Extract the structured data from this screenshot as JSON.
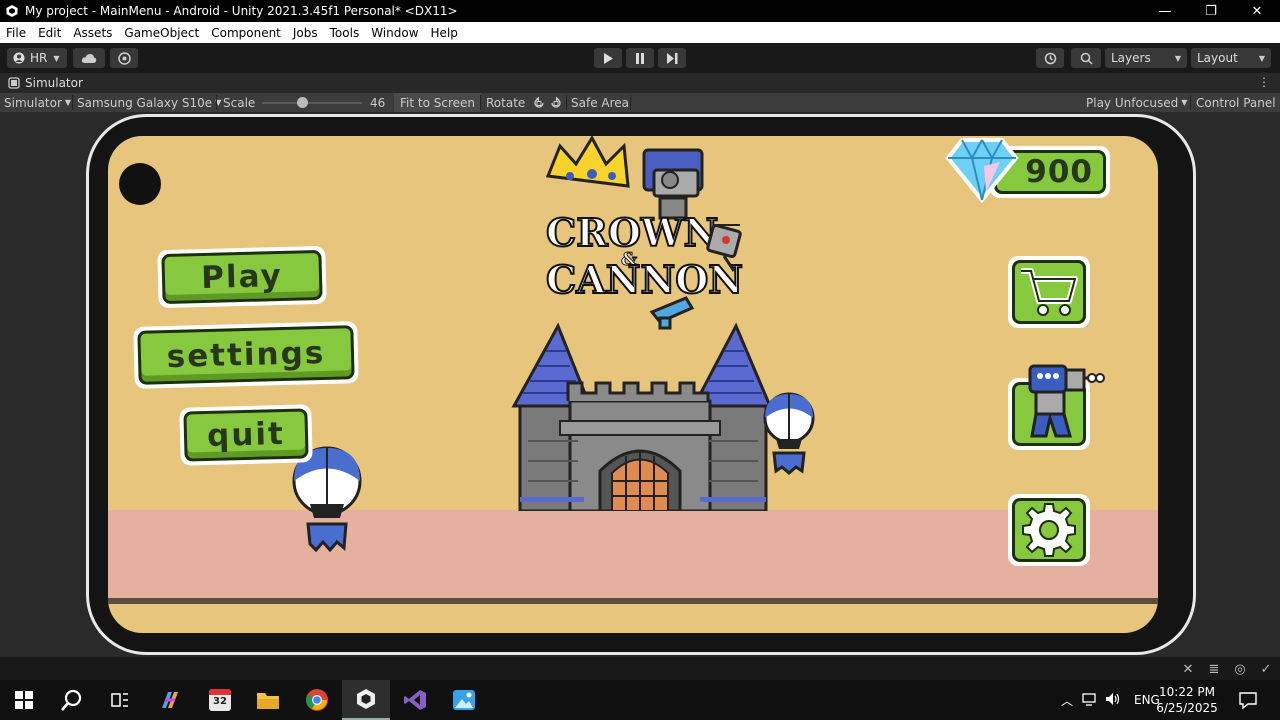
{
  "window": {
    "title": "My project - MainMenu - Android - Unity 2021.3.45f1 Personal* <DX11>",
    "minimize": "—",
    "restore": "❐",
    "close": "✕"
  },
  "menu": [
    "File",
    "Edit",
    "Assets",
    "GameObject",
    "Component",
    "Jobs",
    "Tools",
    "Window",
    "Help"
  ],
  "toolbar": {
    "account": "HR",
    "layers": "Layers",
    "layout": "Layout"
  },
  "tab": {
    "label": "Simulator",
    "more": "⋮"
  },
  "simbar": {
    "mode": "Simulator",
    "device": "Samsung Galaxy S10e",
    "scale_label": "Scale",
    "scale_value": "46",
    "scale_fraction": 0.4,
    "fit": "Fit to Screen",
    "rotate": "Rotate",
    "safe_area": "Safe Area",
    "play_mode": "Play Unfocused",
    "control_panel": "Control Panel"
  },
  "game": {
    "logo_line1": "CROWN",
    "logo_amp": "&",
    "logo_line2": "CANNON",
    "play": "Play",
    "settings": "settings",
    "quit": "quit",
    "gems": "900",
    "colors": {
      "sky": "#e8c57d",
      "ground": "#e6b0a1",
      "button_green": "#86c93f",
      "tower_roof": "#5a6ad0",
      "castle_stone": "#7a7a7a"
    }
  },
  "taskbar": {
    "language": "ENG",
    "time": "10:22 PM",
    "date": "6/25/2025",
    "calendar_badge": "32"
  }
}
